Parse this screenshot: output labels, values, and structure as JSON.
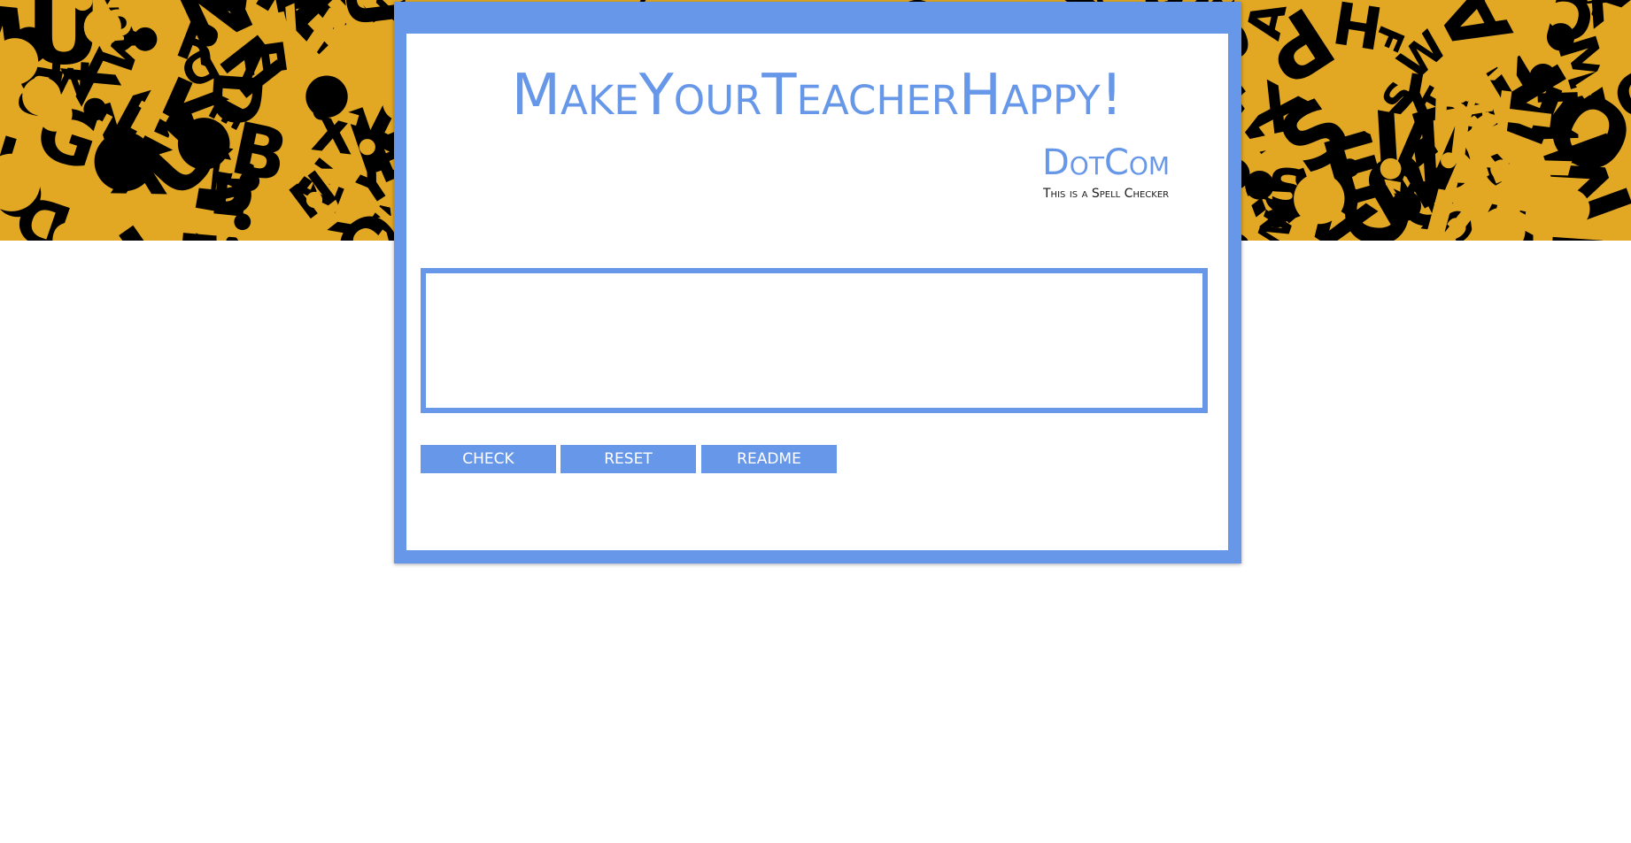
{
  "header": {
    "title": "MakeYourTeacherHappy!",
    "subtitle": "DotCom",
    "tagline": "This is a Spell Checker"
  },
  "editor": {
    "value": "",
    "placeholder": ""
  },
  "buttons": {
    "check": "CHECK",
    "reset": "RESET",
    "readme": "README"
  },
  "colors": {
    "accent": "#6797e8",
    "banner_yellow": "#e2a824",
    "banner_black": "#000000"
  }
}
